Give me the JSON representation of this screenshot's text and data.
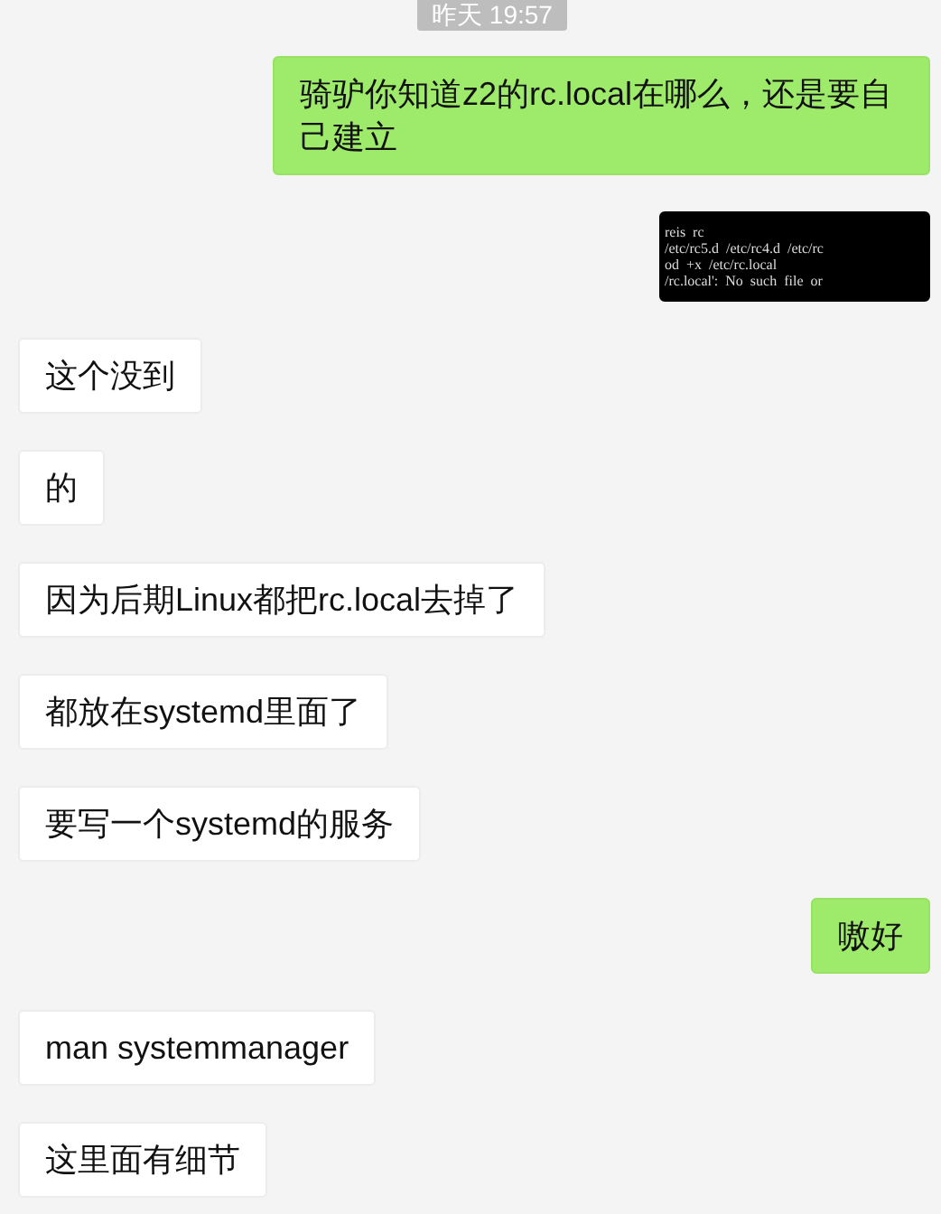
{
  "timestamp": "昨天 19:57",
  "messages": [
    {
      "kind": "text",
      "outgoing": true,
      "text": "骑驴你知道z2的rc.local在哪么，还是要自己建立"
    },
    {
      "kind": "image",
      "outgoing": true,
      "lines": [
        "reis  rc",
        "/etc/rc5.d  /etc/rc4.d  /etc/rc",
        "od  +x  /etc/rc.local",
        "/rc.local':  No  such  file  or"
      ]
    },
    {
      "kind": "text",
      "outgoing": false,
      "text": "这个没到"
    },
    {
      "kind": "text",
      "outgoing": false,
      "text": "的"
    },
    {
      "kind": "text",
      "outgoing": false,
      "text": "因为后期Linux都把rc.local去掉了"
    },
    {
      "kind": "text",
      "outgoing": false,
      "text": "都放在systemd里面了"
    },
    {
      "kind": "text",
      "outgoing": false,
      "text": "要写一个systemd的服务"
    },
    {
      "kind": "text",
      "outgoing": true,
      "text": "嗷好"
    },
    {
      "kind": "text",
      "outgoing": false,
      "text": "man systemmanager"
    },
    {
      "kind": "text",
      "outgoing": false,
      "text": "这里面有细节"
    }
  ]
}
